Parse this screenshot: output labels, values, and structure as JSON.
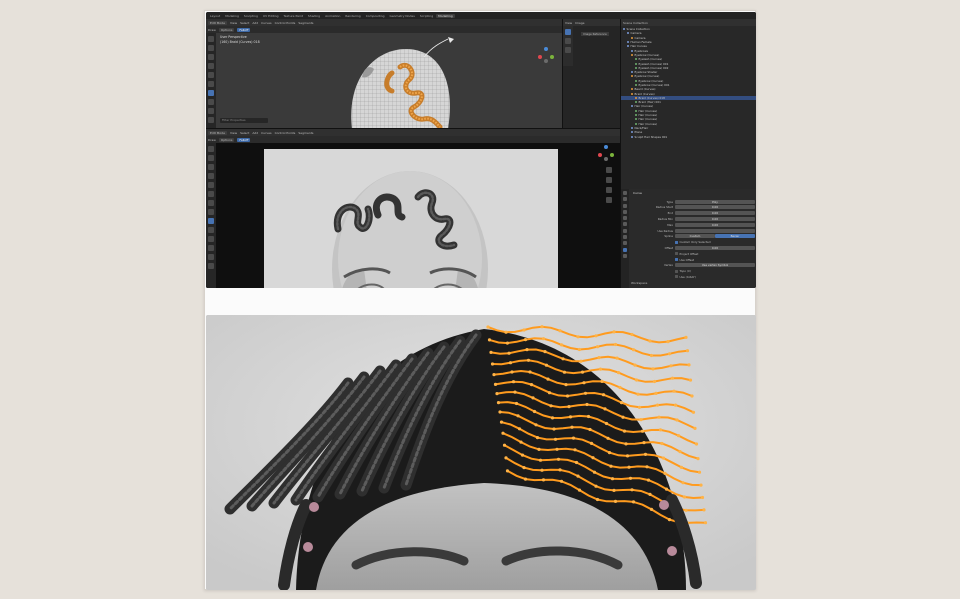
{
  "top_tabs": [
    "Layout",
    "Modeling",
    "Sculpting",
    "UV Editing",
    "Texture Paint",
    "Shading",
    "Animation",
    "Rendering",
    "Compositing",
    "Geometry Nodes",
    "Scripting",
    "Modelling"
  ],
  "top_viewport": {
    "mode": "Edit Mode",
    "menus": [
      "View",
      "Select",
      "Add",
      "Curves",
      "Control Points",
      "Segments"
    ],
    "tool_header": [
      "Draw",
      "Options",
      "Falloff"
    ],
    "overlay_title": "User Perspective",
    "overlay_sub": "(160) Braid (Curves) 018",
    "filter_placeholder": "Filter Properties"
  },
  "bottom_viewport": {
    "mode": "Edit Mode",
    "menus": [
      "View",
      "Select",
      "Add",
      "Curves",
      "Control Points",
      "Segments"
    ],
    "tool_header": [
      "Draw",
      "Options",
      "Falloff"
    ]
  },
  "image_editor": {
    "menus": [
      "View",
      "Image"
    ],
    "title": "Image Reference"
  },
  "outliner": {
    "header": "Scene Collection",
    "rows": [
      {
        "label": "Scene Collection",
        "indent": 0,
        "kind": "col"
      },
      {
        "label": "Camera",
        "indent": 1,
        "kind": "obj"
      },
      {
        "label": "Camera",
        "indent": 2,
        "kind": "og"
      },
      {
        "label": "Human Female",
        "indent": 1,
        "kind": "obj"
      },
      {
        "label": "Hair Curves",
        "indent": 1,
        "kind": "obj"
      },
      {
        "label": "Eyebrows",
        "indent": 2,
        "kind": "obj"
      },
      {
        "label": "Eyebrow (Curves)",
        "indent": 2,
        "kind": "og"
      },
      {
        "label": "Eyelash (Curves)",
        "indent": 3,
        "kind": "gr"
      },
      {
        "label": "Eyelash (Curves) 001",
        "indent": 3,
        "kind": "gr"
      },
      {
        "label": "Eyelash (Curves) 002",
        "indent": 3,
        "kind": "gr"
      },
      {
        "label": "Eyebrow Shader",
        "indent": 2,
        "kind": "obj"
      },
      {
        "label": "Eyebrow (Curves)",
        "indent": 2,
        "kind": "og"
      },
      {
        "label": "Eyebrow (Curves)",
        "indent": 3,
        "kind": "gr"
      },
      {
        "label": "Eyebrow (Curves) 001",
        "indent": 3,
        "kind": "gr"
      },
      {
        "label": "Beard (Curves)",
        "indent": 2,
        "kind": "og"
      },
      {
        "label": "Braid (Curves)",
        "indent": 2,
        "kind": "og"
      },
      {
        "label": "Braid (Curves) 018",
        "indent": 3,
        "kind": "og",
        "selected": true
      },
      {
        "label": "Braid (Hair) 001",
        "indent": 3,
        "kind": "gr"
      },
      {
        "label": "Hair (Curves)",
        "indent": 2,
        "kind": "obj"
      },
      {
        "label": "Hair (Curves)",
        "indent": 3,
        "kind": "gr"
      },
      {
        "label": "Hair (Curves)",
        "indent": 3,
        "kind": "gr"
      },
      {
        "label": "Hair (Curves)",
        "indent": 3,
        "kind": "gr"
      },
      {
        "label": "Hair (Curves)",
        "indent": 3,
        "kind": "gr"
      },
      {
        "label": "Neck/Hair",
        "indent": 2,
        "kind": "obj"
      },
      {
        "label": "Plane",
        "indent": 2,
        "kind": "obj"
      },
      {
        "label": "Sculpt Hair Shapes 001",
        "indent": 2,
        "kind": "obj"
      }
    ]
  },
  "properties": {
    "section": "Curve",
    "rows": [
      {
        "label": "Type",
        "value": "Poly"
      },
      {
        "label": "Radius Start",
        "value": "0.00"
      },
      {
        "label": "End",
        "value": "0.00"
      },
      {
        "label": "Radius Min",
        "value": "0.00"
      },
      {
        "label": "Max",
        "value": "0.00"
      },
      {
        "label": "Use Radius",
        "value": ""
      },
      {
        "label": "Spline",
        "value": "Custom",
        "active": "Bezier"
      },
      {
        "label": "",
        "value": "Custom Only Selected",
        "check": true
      },
      {
        "label": "Offset",
        "value": "0.00"
      },
      {
        "label": "",
        "value": "Project Offset",
        "check": false
      },
      {
        "label": "",
        "value": "Use Offset",
        "check": true
      },
      {
        "label": "Vertex",
        "value": "Use vertex Symbol"
      },
      {
        "label": "",
        "value": "Topo (X)",
        "check": false
      },
      {
        "label": "",
        "value": "Use (X-RAY)",
        "check": false
      }
    ],
    "footer": "Workspace"
  },
  "colors": {
    "accent": "#4773b3",
    "curve_orange": "#ff9b1e",
    "ui_bg": "#1d1d1d",
    "page_bg": "#e6e1da"
  }
}
